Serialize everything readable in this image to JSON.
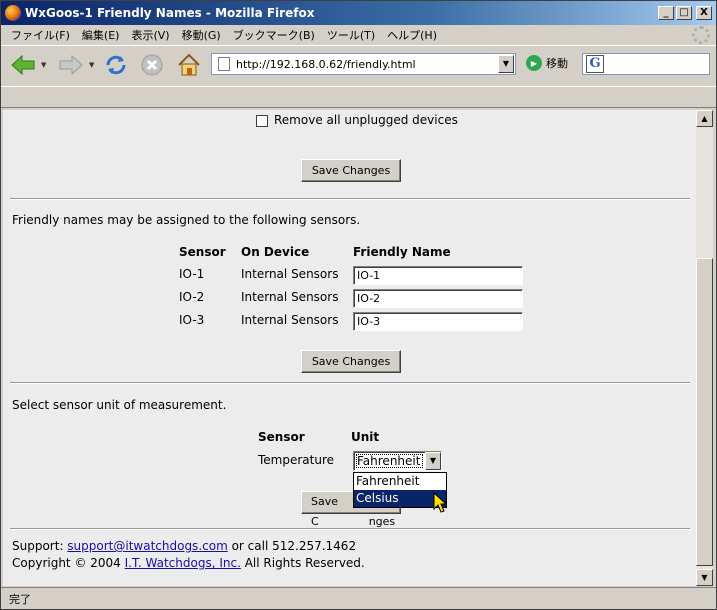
{
  "window": {
    "title": "WxGoos-1 Friendly Names - Mozilla Firefox",
    "controls": {
      "minimize": "_",
      "maximize": "□",
      "close": "X"
    }
  },
  "menu": {
    "items": [
      "ファイル(F)",
      "編集(E)",
      "表示(V)",
      "移動(G)",
      "ブックマーク(B)",
      "ツール(T)",
      "ヘルプ(H)"
    ]
  },
  "toolbar": {
    "url": "http://192.168.0.62/friendly.html",
    "go_label": "移動"
  },
  "page": {
    "remove_unplugged_label": "Remove all unplugged devices",
    "save_label": "Save Changes",
    "intro_text": "Friendly names may be assigned to the following sensors.",
    "names_table": {
      "headers": [
        "Sensor",
        "On Device",
        "Friendly Name"
      ],
      "rows": [
        {
          "sensor": "IO-1",
          "device": "Internal Sensors",
          "name": "IO-1"
        },
        {
          "sensor": "IO-2",
          "device": "Internal Sensors",
          "name": "IO-2"
        },
        {
          "sensor": "IO-3",
          "device": "Internal Sensors",
          "name": "IO-3"
        }
      ]
    },
    "unit_intro": "Select sensor unit of measurement.",
    "unit_table": {
      "headers": [
        "Sensor",
        "Unit"
      ],
      "sensor": "Temperature",
      "selected": "Fahrenheit",
      "options": [
        "Fahrenheit",
        "Celsius"
      ]
    },
    "save_label_partial": "Save C",
    "save_label_tail": "nges",
    "support_prefix": "Support: ",
    "support_email": "support@itwatchdogs.com",
    "support_suffix": " or call 512.257.1462",
    "copyright_prefix": "Copyright © 2004 ",
    "company_link": "I.T. Watchdogs, Inc.",
    "copyright_suffix": " All Rights Reserved."
  },
  "status": {
    "text": "完了"
  },
  "colors": {
    "selection": "#0a246a",
    "link": "#1a0dab"
  }
}
